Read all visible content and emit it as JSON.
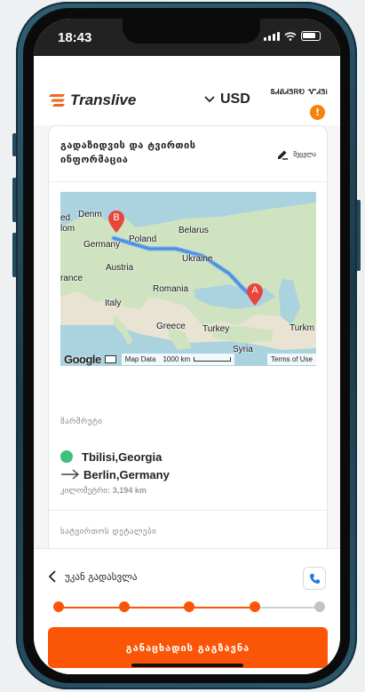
{
  "status_bar": {
    "time": "18:43"
  },
  "header": {
    "brand": "Translive",
    "currency": "USD",
    "offer_label": "ՏᏗᏰᏗᏕᏒᎧ ᏉᏗᏕᎥ",
    "offer_badge": "!"
  },
  "card": {
    "title": "გადაზიდვის და ტვირთის ინფორმაცია",
    "edit_label": "შეცვლა",
    "map": {
      "labels": [
        "Denm",
        "ed",
        "lom",
        "Germany",
        "Poland",
        "Belarus",
        "Ukraine",
        "Austria",
        "rance",
        "Romania",
        "Italy",
        "Greece",
        "Turkey",
        "Syria",
        "Turkm"
      ],
      "marker_a": "A",
      "marker_b": "B",
      "google": "Google",
      "map_data": "Map Data",
      "scale": "1000 km",
      "terms": "Terms of Use"
    },
    "route_label": "მარშრუტი",
    "origin": "Tbilisi,Georgia",
    "destination": "Berlin,Germany",
    "distance_label": "კილომეტრი:",
    "distance_value": "3,194 km",
    "cargo_label": "სატვირთოს დეტალები"
  },
  "footer": {
    "back_label": "უკან გადასვლა",
    "submit_label": "განაცხადის გაგზავნა",
    "steps_completed": 4,
    "steps_total": 5
  },
  "colors": {
    "accent": "#fb5507",
    "orange_badge": "#f5820b",
    "green_dot": "#3ec07a",
    "marker_red": "#e8453c"
  }
}
